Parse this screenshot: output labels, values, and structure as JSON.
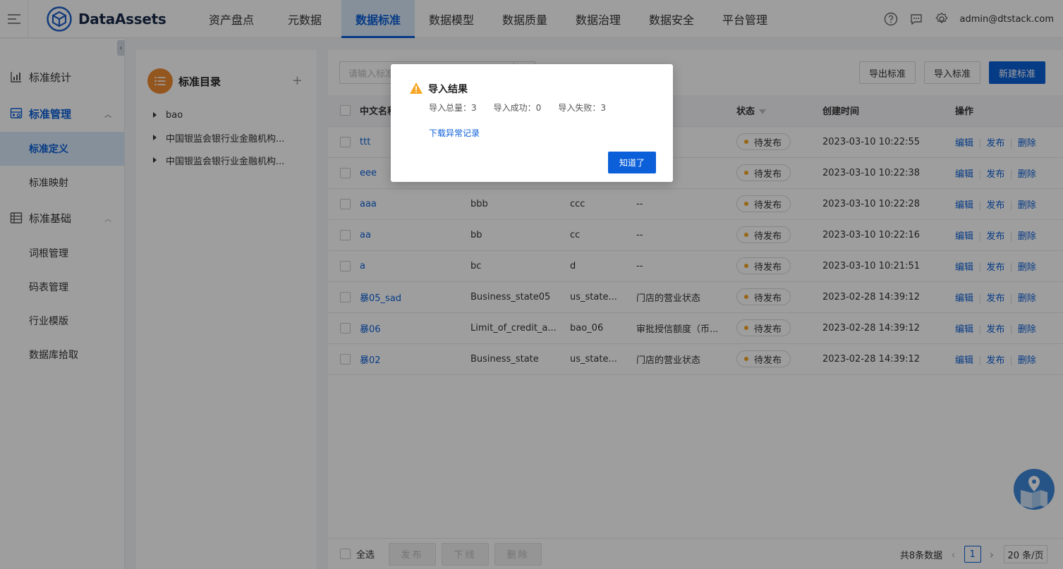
{
  "header": {
    "app_name": "DataAssets",
    "nav": [
      "资产盘点",
      "元数据",
      "数据标准",
      "数据模型",
      "数据质量",
      "数据治理",
      "数据安全",
      "平台管理"
    ],
    "active_nav": "数据标准",
    "user": "admin@dtstack.com"
  },
  "sidebar": {
    "item_stats": "标准统计",
    "group_manage": "标准管理",
    "item_define": "标准定义",
    "item_mapping": "标准映射",
    "group_base": "标准基础",
    "item_root": "词根管理",
    "item_code": "码表管理",
    "item_industry": "行业模版",
    "item_db": "数据库拾取"
  },
  "catalog": {
    "title": "标准目录",
    "nodes": [
      "bao",
      "中国银监会银行业金融机构...",
      "中国银监会银行业金融机构..."
    ]
  },
  "toolbar": {
    "search_placeholder": "请输入标准",
    "export_label": "导出标准",
    "import_label": "导入标准",
    "new_label": "新建标准"
  },
  "table": {
    "headers": {
      "cn_name": "中文名称",
      "status": "状态",
      "created": "创建时间",
      "ops": "操作"
    },
    "rows": [
      {
        "cn": "ttt",
        "en": "",
        "abbr": "",
        "desc": "",
        "status": "待发布",
        "time": "2023-03-10 10:22:55"
      },
      {
        "cn": "eee",
        "en": "",
        "abbr": "",
        "desc": "",
        "status": "待发布",
        "time": "2023-03-10 10:22:38"
      },
      {
        "cn": "aaa",
        "en": "bbb",
        "abbr": "ccc",
        "desc": "--",
        "status": "待发布",
        "time": "2023-03-10 10:22:28"
      },
      {
        "cn": "aa",
        "en": "bb",
        "abbr": "cc",
        "desc": "--",
        "status": "待发布",
        "time": "2023-03-10 10:22:16"
      },
      {
        "cn": "a",
        "en": "bc",
        "abbr": "d",
        "desc": "--",
        "status": "待发布",
        "time": "2023-03-10 10:21:51"
      },
      {
        "cn": "暴05_sad",
        "en": "Business_state05",
        "abbr": "us_state...",
        "desc": "门店的营业状态",
        "status": "待发布",
        "time": "2023-02-28 14:39:12"
      },
      {
        "cn": "暴06",
        "en": "Limit_of_credit_a...",
        "abbr": "bao_06",
        "desc": "审批授信额度（币...",
        "status": "待发布",
        "time": "2023-02-28 14:39:12"
      },
      {
        "cn": "暴02",
        "en": "Business_state",
        "abbr": "us_state...",
        "desc": "门店的营业状态",
        "status": "待发布",
        "time": "2023-02-28 14:39:12"
      }
    ],
    "op_edit": "编辑",
    "op_publish": "发布",
    "op_delete": "删除"
  },
  "footer": {
    "select_all": "全选",
    "publish": "发布",
    "offline": "下线",
    "delete": "删除",
    "total": "共8条数据",
    "page": "1",
    "page_size": "20 条/页"
  },
  "dialog": {
    "title": "导入结果",
    "total_label": "导入总量：",
    "total_value": "3",
    "success_label": "导入成功：",
    "success_value": "0",
    "fail_label": "导入失败：",
    "fail_value": "3",
    "download_link": "下载异常记录",
    "ok_button": "知道了"
  }
}
